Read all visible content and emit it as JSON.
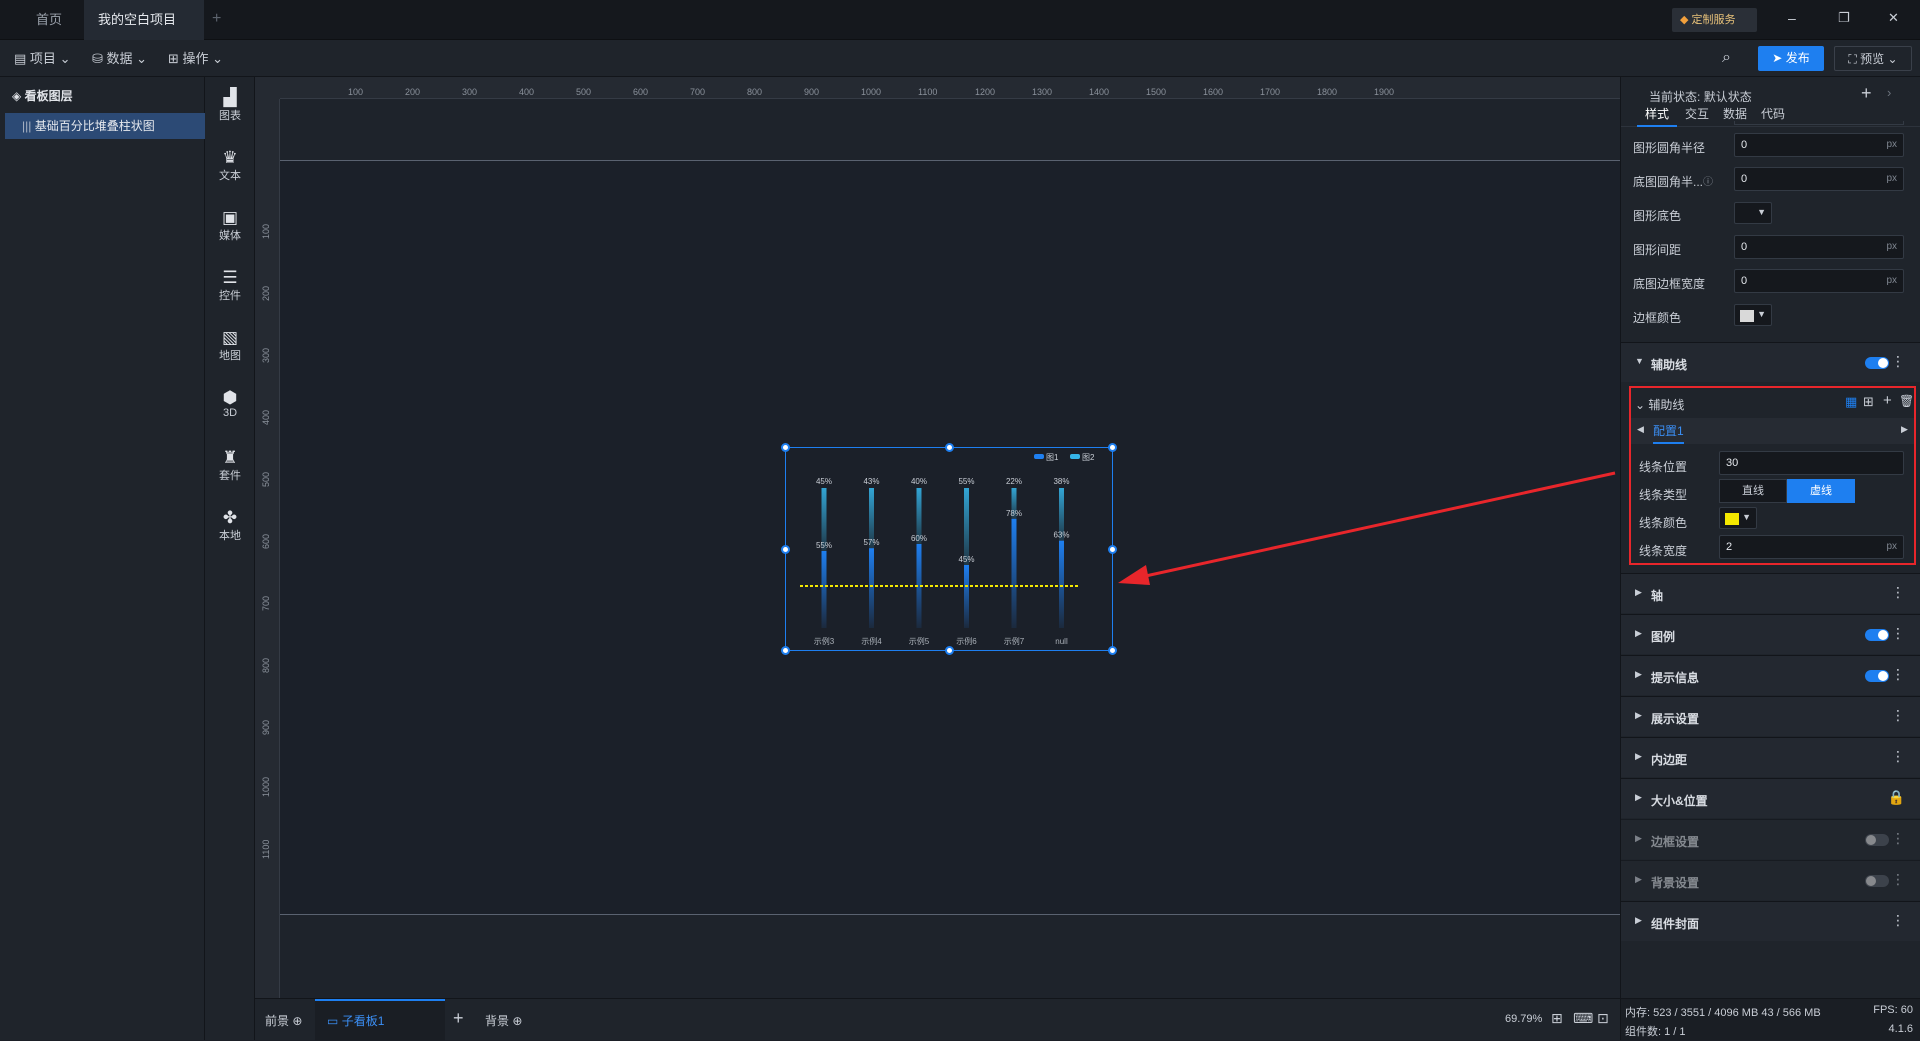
{
  "tabs": {
    "home": "首页",
    "project": "我的空白项目"
  },
  "titlebar": {
    "custom_service": "定制服务",
    "minimize": "–",
    "restore": "❐",
    "close": "✕"
  },
  "toolbar": {
    "project": "项目",
    "data": "数据",
    "operate": "操作",
    "publish": "发布",
    "preview": "预览"
  },
  "layers": {
    "title": "看板图层",
    "item": "基础百分比堆叠柱状图"
  },
  "components": [
    "图表",
    "文本",
    "媒体",
    "控件",
    "地图",
    "3D",
    "套件",
    "本地"
  ],
  "ruler": {
    "top": [
      "100",
      "200",
      "300",
      "400",
      "500",
      "600",
      "700",
      "800",
      "900",
      "1000",
      "1100",
      "1200",
      "1300",
      "1400",
      "1500",
      "1600",
      "1700",
      "1800",
      "1900"
    ],
    "left": [
      "100",
      "200",
      "300",
      "400",
      "500",
      "600",
      "700",
      "800",
      "900",
      "1000",
      "1100"
    ]
  },
  "chart_data": {
    "type": "bar",
    "stacked": "percent",
    "categories": [
      "示例3",
      "示例4",
      "示例5",
      "示例6",
      "示例7",
      "null"
    ],
    "series": [
      {
        "name": "图1",
        "values": [
          55,
          57,
          60,
          45,
          78,
          63
        ]
      },
      {
        "name": "图2",
        "values": [
          45,
          43,
          40,
          55,
          22,
          38
        ]
      }
    ],
    "legend_position": "top-right",
    "guide_line": {
      "position": 30,
      "type": "dashed",
      "color": "#f5e800"
    },
    "series_color": "#1e7ff0"
  },
  "bottom": {
    "foreground": "前景",
    "sub_board": "子看板1",
    "background": "背景",
    "zoom": "69.79%"
  },
  "panel": {
    "state_label": "当前状态:",
    "state_value": "默认状态",
    "tabs": [
      "样式",
      "交互",
      "数据",
      "代码"
    ],
    "rows": [
      {
        "label": "图形圆角半径",
        "value": "0",
        "unit": "px"
      },
      {
        "label": "底图圆角半...",
        "value": "0",
        "unit": "px"
      },
      {
        "label": "图形底色"
      },
      {
        "label": "图形间距",
        "value": "0",
        "unit": "px"
      },
      {
        "label": "底图边框宽度",
        "value": "0",
        "unit": "px"
      },
      {
        "label": "边框颜色"
      }
    ],
    "guide_section": "辅助线",
    "guide_sub": "辅助线",
    "config_tab": "配置1",
    "guide_fields": {
      "position_label": "线条位置",
      "position_value": "30",
      "type_label": "线条类型",
      "type_solid": "直线",
      "type_dashed": "虚线",
      "color_label": "线条颜色",
      "width_label": "线条宽度",
      "width_value": "2",
      "width_unit": "px"
    },
    "sections": [
      "轴",
      "图例",
      "提示信息",
      "展示设置",
      "内边距",
      "大小&位置",
      "边框设置",
      "背景设置",
      "组件封面"
    ]
  },
  "status": {
    "memory": "内存: 523 / 3551 / 4096 MB 43 / 566 MB",
    "fps": "FPS: 60",
    "count": "组件数: 1 / 1",
    "version": "4.1.6"
  }
}
